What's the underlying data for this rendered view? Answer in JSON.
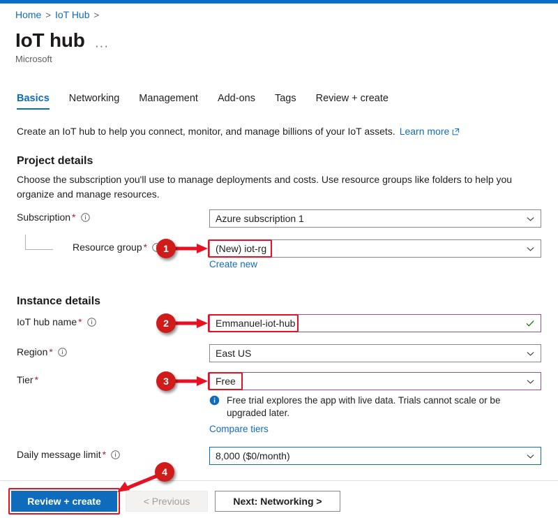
{
  "topbar": {
    "color": "#0a6cc9"
  },
  "breadcrumb": {
    "items": [
      "Home",
      "IoT Hub"
    ],
    "separator": ">"
  },
  "header": {
    "title": "IoT hub",
    "ellipsis": "···",
    "publisher": "Microsoft"
  },
  "tabs": [
    {
      "label": "Basics",
      "active": true
    },
    {
      "label": "Networking",
      "active": false
    },
    {
      "label": "Management",
      "active": false
    },
    {
      "label": "Add-ons",
      "active": false
    },
    {
      "label": "Tags",
      "active": false
    },
    {
      "label": "Review + create",
      "active": false
    }
  ],
  "intro": {
    "text": "Create an IoT hub to help you connect, monitor, and manage billions of your IoT assets.",
    "link": "Learn more"
  },
  "project_details": {
    "title": "Project details",
    "description": "Choose the subscription you'll use to manage deployments and costs. Use resource groups like folders to help you organize and manage resources.",
    "subscription": {
      "label": "Subscription",
      "required": "*",
      "value": "Azure subscription 1"
    },
    "resource_group": {
      "label": "Resource group",
      "required": "*",
      "value": "(New) iot-rg",
      "create_new_link": "Create new"
    }
  },
  "instance_details": {
    "title": "Instance details",
    "iot_hub_name": {
      "label": "IoT hub name",
      "required": "*",
      "value": "Emmanuel-iot-hub",
      "validated": true
    },
    "region": {
      "label": "Region",
      "required": "*",
      "value": "East US"
    },
    "tier": {
      "label": "Tier",
      "required": "*",
      "value": "Free",
      "info_message": "Free trial explores the app with live data. Trials cannot scale or be upgraded later.",
      "compare_link": "Compare tiers"
    },
    "daily_message_limit": {
      "label": "Daily message limit",
      "required": "*",
      "value": "8,000 ($0/month)"
    }
  },
  "footer": {
    "review_create": "Review + create",
    "previous": "< Previous",
    "next": "Next: Networking >"
  },
  "annotations": {
    "badges": [
      {
        "number": "1",
        "target": "resource-group-field"
      },
      {
        "number": "2",
        "target": "iot-hub-name-field"
      },
      {
        "number": "3",
        "target": "tier-field"
      },
      {
        "number": "4",
        "target": "review-create-button"
      }
    ],
    "color": "#d01b1b",
    "highlight_color": "#e81123"
  }
}
